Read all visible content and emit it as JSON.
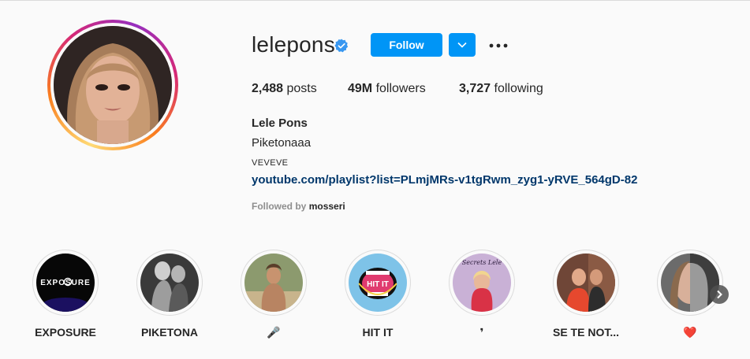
{
  "profile": {
    "username": "lelepons",
    "verified_icon": "verified-badge-icon",
    "follow_label": "Follow",
    "dropdown_icon": "chevron-down-icon",
    "more_icon": "more-options-icon",
    "stats": {
      "posts_count": "2,488",
      "posts_label": "posts",
      "followers_count": "49M",
      "followers_label": "followers",
      "following_count": "3,727",
      "following_label": "following"
    },
    "full_name": "Lele Pons",
    "bio": "Piketonaaa",
    "category": "VEVEVE",
    "link": "youtube.com/playlist?list=PLmjMRs-v1tgRwm_zyg1-yRVE_564gD-82",
    "followed_by_prefix": "Followed by",
    "followed_by_user": "mosseri"
  },
  "highlights": [
    {
      "label": "EXPOSURE",
      "cover_text": "EXPOSURE"
    },
    {
      "label": "PIKETONA"
    },
    {
      "label": "🎤"
    },
    {
      "label": "HIT IT",
      "cover_text": "HIT IT"
    },
    {
      "label": "❜",
      "cover_text": "Secrets Lele"
    },
    {
      "label": "SE TE NOT..."
    },
    {
      "label": "❤️"
    }
  ],
  "colors": {
    "accent": "#0095f6",
    "link": "#00376b",
    "text": "#262626",
    "muted": "#8e8e8e",
    "background": "#fafafa"
  }
}
